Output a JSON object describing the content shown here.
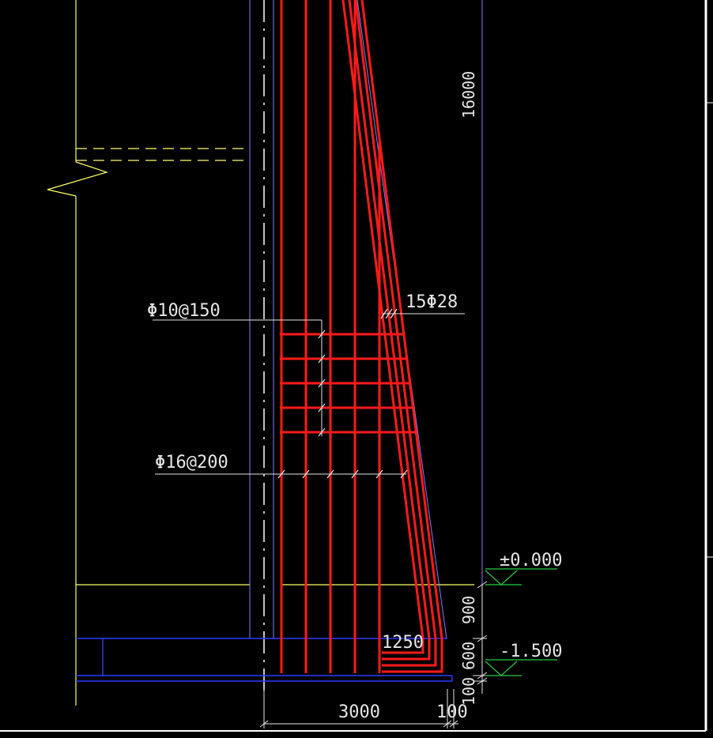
{
  "colors": {
    "background": "#000000",
    "outline": "#ffff66",
    "rebar": "#ff1a1a",
    "structure": "#8080ff",
    "footing": "#2b3bff",
    "elevation_mark": "#22cc44",
    "text": "#e6e6e6",
    "frame": "#ffffff"
  },
  "labels": {
    "stirrup_spec": "Φ10@150",
    "distribution_bar_spec": "Φ16@200",
    "main_bar_spec": "15Φ28"
  },
  "dimensions": {
    "total_height": "16000",
    "base_width": "3000",
    "offset": "100",
    "depth_upper": "900",
    "footing_thickness": "600",
    "cover": "100",
    "heel_length": "1250"
  },
  "elevations": {
    "ground": "±0.000",
    "bottom": "-1.500"
  }
}
